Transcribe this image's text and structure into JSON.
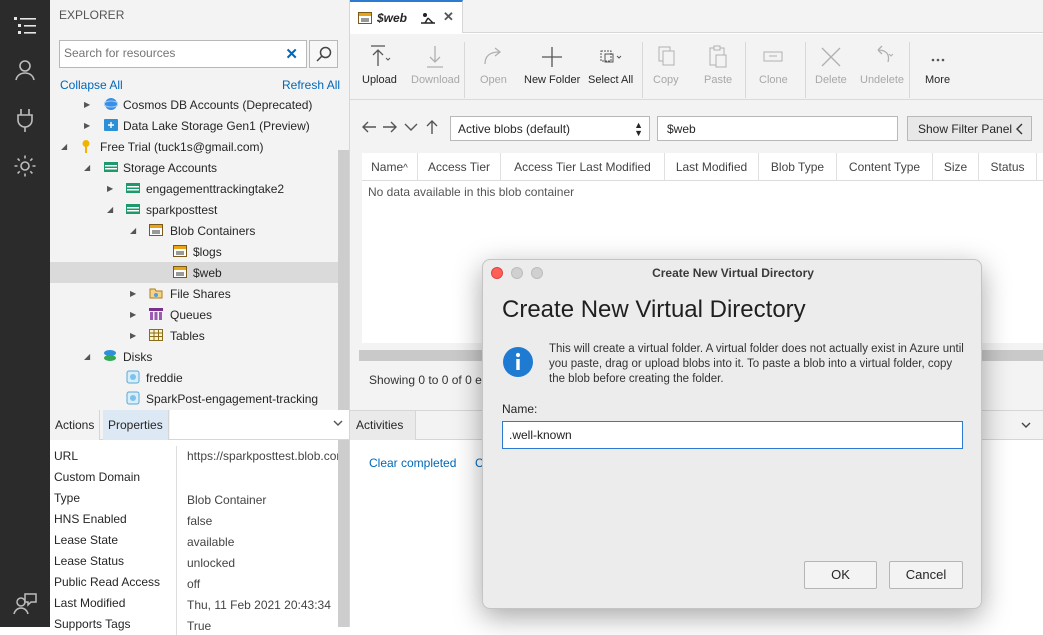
{
  "explorer": {
    "title": "EXPLORER",
    "search_placeholder": "Search for resources",
    "collapse_all": "Collapse All",
    "refresh_all": "Refresh All",
    "tree": [
      {
        "label": "Cosmos DB Accounts (Deprecated)",
        "icon": "cosmos-icon"
      },
      {
        "label": "Data Lake Storage Gen1 (Preview)",
        "icon": "datalake-icon"
      },
      {
        "label": "Free Trial (tuck1s@gmail.com)",
        "icon": "key-icon"
      },
      {
        "label": "Storage Accounts",
        "icon": "storage-icon"
      },
      {
        "label": "engagementtrackingtake2",
        "icon": "storage-account-icon"
      },
      {
        "label": "sparkposttest",
        "icon": "storage-account-icon"
      },
      {
        "label": "Blob Containers",
        "icon": "blob-containers-icon"
      },
      {
        "label": "$logs",
        "icon": "container-icon"
      },
      {
        "label": "$web",
        "icon": "container-icon"
      },
      {
        "label": "File Shares",
        "icon": "file-shares-icon"
      },
      {
        "label": "Queues",
        "icon": "queues-icon"
      },
      {
        "label": "Tables",
        "icon": "tables-icon"
      },
      {
        "label": "Disks",
        "icon": "disks-icon"
      },
      {
        "label": "freddie",
        "icon": "disk-icon"
      },
      {
        "label": "SparkPost-engagement-tracking",
        "icon": "disk-icon"
      }
    ]
  },
  "bottom_left": {
    "tabs": [
      "Actions",
      "Properties"
    ],
    "properties": [
      {
        "key": "URL",
        "value": "https://sparkposttest.blob.core"
      },
      {
        "key": "Custom Domain",
        "value": ""
      },
      {
        "key": "Type",
        "value": "Blob Container"
      },
      {
        "key": "HNS Enabled",
        "value": "false"
      },
      {
        "key": "Lease State",
        "value": "available"
      },
      {
        "key": "Lease Status",
        "value": "unlocked"
      },
      {
        "key": "Public Read Access",
        "value": "off"
      },
      {
        "key": "Last Modified",
        "value": "Thu, 11 Feb 2021 20:43:34"
      },
      {
        "key": "Supports Tags",
        "value": "True"
      }
    ]
  },
  "doc_tab": {
    "label": "$web"
  },
  "toolbar": {
    "buttons": [
      {
        "label": "Upload",
        "enabled": true
      },
      {
        "label": "Download",
        "enabled": false
      },
      {
        "label": "Open",
        "enabled": false
      },
      {
        "label": "New Folder",
        "enabled": true
      },
      {
        "label": "Select All",
        "enabled": true
      },
      {
        "label": "Copy",
        "enabled": false
      },
      {
        "label": "Paste",
        "enabled": false
      },
      {
        "label": "Clone",
        "enabled": false
      },
      {
        "label": "Delete",
        "enabled": false
      },
      {
        "label": "Undelete",
        "enabled": false
      },
      {
        "label": "More",
        "enabled": true
      }
    ]
  },
  "nav": {
    "blob_view": "Active blobs (default)",
    "path": "$web",
    "filter_button": "Show Filter Panel"
  },
  "grid": {
    "columns": [
      "Name",
      "Access Tier",
      "Access Tier Last Modified",
      "Last Modified",
      "Blob Type",
      "Content Type",
      "Size",
      "Status"
    ],
    "empty_message": "No data available in this blob container",
    "footer": "Showing 0 to 0 of 0 e"
  },
  "activities": {
    "tab": "Activities",
    "clear_completed": "Clear completed",
    "clear_successful_partial": "C"
  },
  "dialog": {
    "window_title": "Create New Virtual Directory",
    "heading": "Create New Virtual Directory",
    "message": "This will create a virtual folder. A virtual folder does not actually exist in Azure until you paste, drag or upload blobs into it. To paste a blob into a virtual folder, copy the blob before creating the folder.",
    "name_label": "Name:",
    "name_value": ".well-known",
    "ok": "OK",
    "cancel": "Cancel"
  },
  "colors": {
    "accent": "#0067b8",
    "tab_accent": "#2b7bd0",
    "activity_bar": "#2b2b2b"
  }
}
